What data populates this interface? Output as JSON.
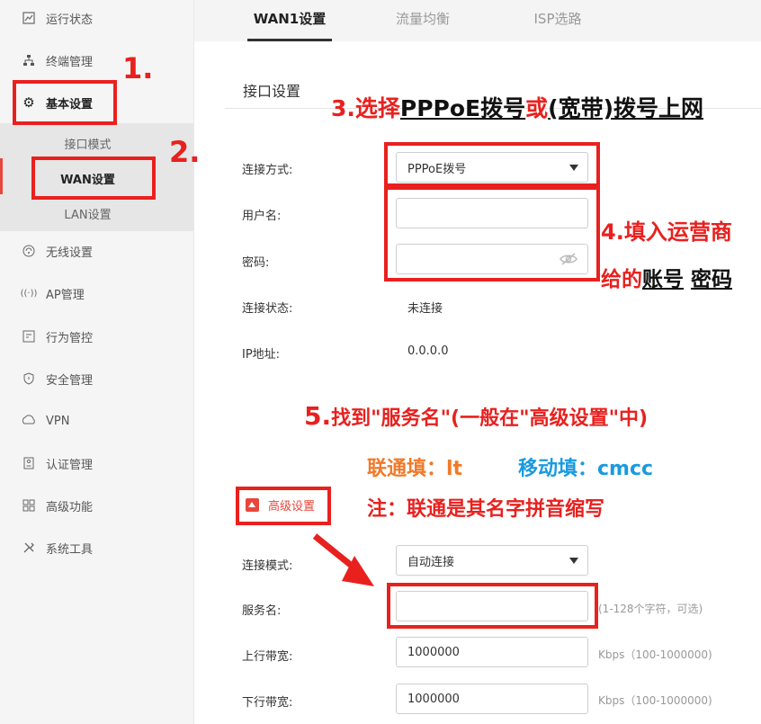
{
  "sidebar": {
    "items": [
      {
        "label": "运行状态",
        "icon": "chart-icon"
      },
      {
        "label": "终端管理",
        "icon": "network-icon"
      },
      {
        "label": "基本设置",
        "icon": "gear-icon"
      },
      {
        "label": "无线设置",
        "icon": "wifi-icon"
      },
      {
        "label": "AP管理",
        "icon": "ap-icon"
      },
      {
        "label": "行为管控",
        "icon": "behavior-icon"
      },
      {
        "label": "安全管理",
        "icon": "shield-icon"
      },
      {
        "label": "VPN",
        "icon": "vpn-icon"
      },
      {
        "label": "认证管理",
        "icon": "id-card-icon"
      },
      {
        "label": "高级功能",
        "icon": "grid-icon"
      },
      {
        "label": "系统工具",
        "icon": "tools-icon"
      }
    ],
    "submenu": [
      "接口模式",
      "WAN设置",
      "LAN设置"
    ]
  },
  "tabs": [
    "WAN1设置",
    "流量均衡",
    "ISP选路"
  ],
  "section_title": "接口设置",
  "form": {
    "conn_method_label": "连接方式:",
    "conn_method_value": "PPPoE拨号",
    "username_label": "用户名:",
    "password_label": "密码:",
    "status_label": "连接状态:",
    "status_value": "未连接",
    "ip_label": "IP地址:",
    "ip_value": "0.0.0.0",
    "advanced_label": "高级设置",
    "conn_mode_label": "连接模式:",
    "conn_mode_value": "自动连接",
    "service_label": "服务名:",
    "service_hint": "(1-128个字符，可选)",
    "up_label": "上行带宽:",
    "up_value": "1000000",
    "up_hint": "Kbps（100-1000000)",
    "down_label": "下行带宽:",
    "down_value": "1000000",
    "down_hint": "Kbps（100-1000000)"
  },
  "annotations": {
    "step1": "1.",
    "step2": "2.",
    "step3_prefix": "3.选择",
    "step3_pppoe": "PPPoE拨号",
    "step3_or": "或",
    "step3_broadband": "(宽带)拨号上网",
    "step4_line1": "4.填入运营商",
    "step4_line2_prefix": "给的",
    "step4_account": "账号",
    "step4_password": "密码",
    "step5_prefix": "5.",
    "step5_text": "找到\"服务名\"(一般在\"高级设置\"中)",
    "unicom": "联通填：lt",
    "mobile": "移动填：cmcc",
    "note": "注：联通是其名字拼音缩写"
  },
  "colors": {
    "accent_red": "#e8211f",
    "orange": "#f07a2a",
    "blue": "#1a9ae0"
  }
}
